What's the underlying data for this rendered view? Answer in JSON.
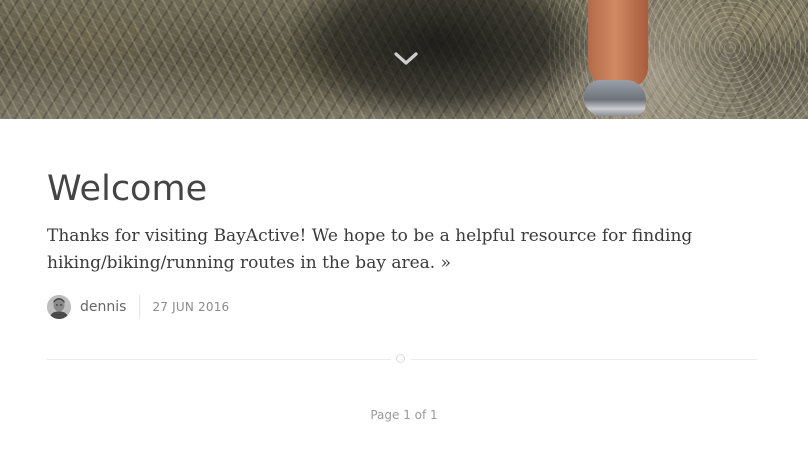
{
  "hero": {
    "scroll_icon": "chevron-down-icon"
  },
  "post": {
    "title": "Welcome",
    "excerpt": "Thanks for visiting BayActive! We hope to be a helpful resource for finding hiking/biking/running routes in the bay area.",
    "read_more": "»",
    "author": "dennis",
    "date": "27 JUN 2016"
  },
  "pagination": {
    "text": "Page 1 of 1"
  },
  "colors": {
    "title": "#444444",
    "body_text": "#3a3a3a",
    "muted": "#9a9a9a",
    "divider": "#ececec"
  }
}
